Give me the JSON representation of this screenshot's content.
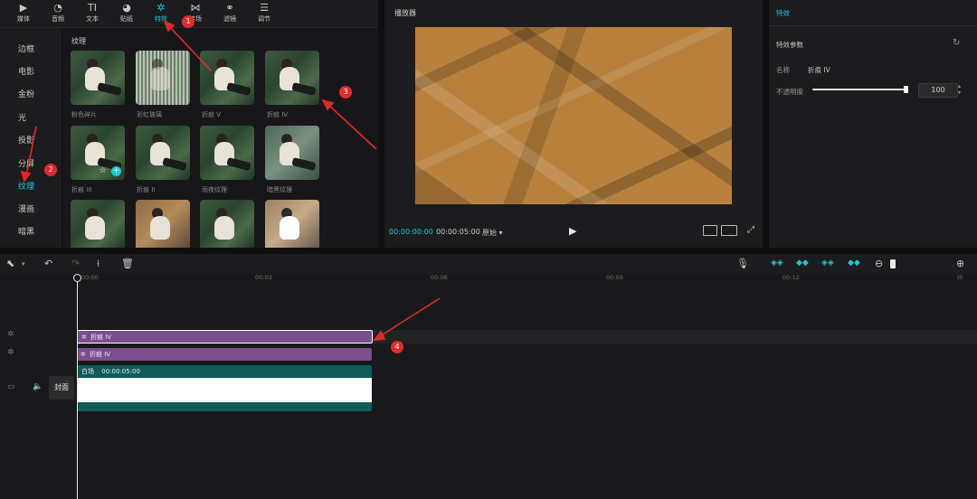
{
  "toolbar": {
    "items": [
      {
        "label": "媒体",
        "icon": "media-icon"
      },
      {
        "label": "音频",
        "icon": "audio-icon"
      },
      {
        "label": "文本",
        "icon": "text-icon"
      },
      {
        "label": "贴纸",
        "icon": "sticker-icon"
      },
      {
        "label": "特效",
        "icon": "effects-icon"
      },
      {
        "label": "转场",
        "icon": "transition-icon"
      },
      {
        "label": "滤镜",
        "icon": "filter-icon"
      },
      {
        "label": "调节",
        "icon": "adjust-icon"
      }
    ],
    "active_index": 4
  },
  "categories": [
    "边框",
    "电影",
    "金粉",
    "光",
    "投影",
    "分屏",
    "纹理",
    "漫画",
    "暗黑"
  ],
  "active_category": "纹理",
  "effects_section": {
    "title": "纹理",
    "items": [
      {
        "label": "粉色碎片"
      },
      {
        "label": "彩虹玻璃"
      },
      {
        "label": "折痕 V"
      },
      {
        "label": "折痕 IV"
      },
      {
        "label": "折痕 III"
      },
      {
        "label": "折痕 II"
      },
      {
        "label": "雨夜纹理"
      },
      {
        "label": "暗黑纹理"
      },
      {
        "label": ""
      },
      {
        "label": ""
      },
      {
        "label": ""
      },
      {
        "label": ""
      }
    ]
  },
  "player": {
    "title": "播放器",
    "current_time": "00:00:00:00",
    "total_time": "00:00:05:00",
    "ratio_label": "原始",
    "preview_color": "#b7813d"
  },
  "properties": {
    "tab_title": "特效",
    "section": "特效参数",
    "name_label": "名称",
    "name_value": "折痕 IV",
    "opacity_label": "不透明度",
    "opacity_value": "100",
    "opacity_fraction": 1.0
  },
  "timeline": {
    "ruler": [
      "00:00",
      "00:03",
      "00:06",
      "00:09",
      "00:12"
    ],
    "tracks": {
      "effect1_label": "折痕 IV",
      "effect2_label": "折痕 IV",
      "video_label": "白场",
      "video_duration": "00:00:05:00",
      "cover_label": "封面"
    },
    "colors": {
      "effect": "#7a4f8c",
      "video": "#0e5b58"
    }
  },
  "annotations": [
    "1",
    "2",
    "3",
    "4"
  ],
  "accent_color": "#22c6d4",
  "annotation_color": "#e02b2b"
}
